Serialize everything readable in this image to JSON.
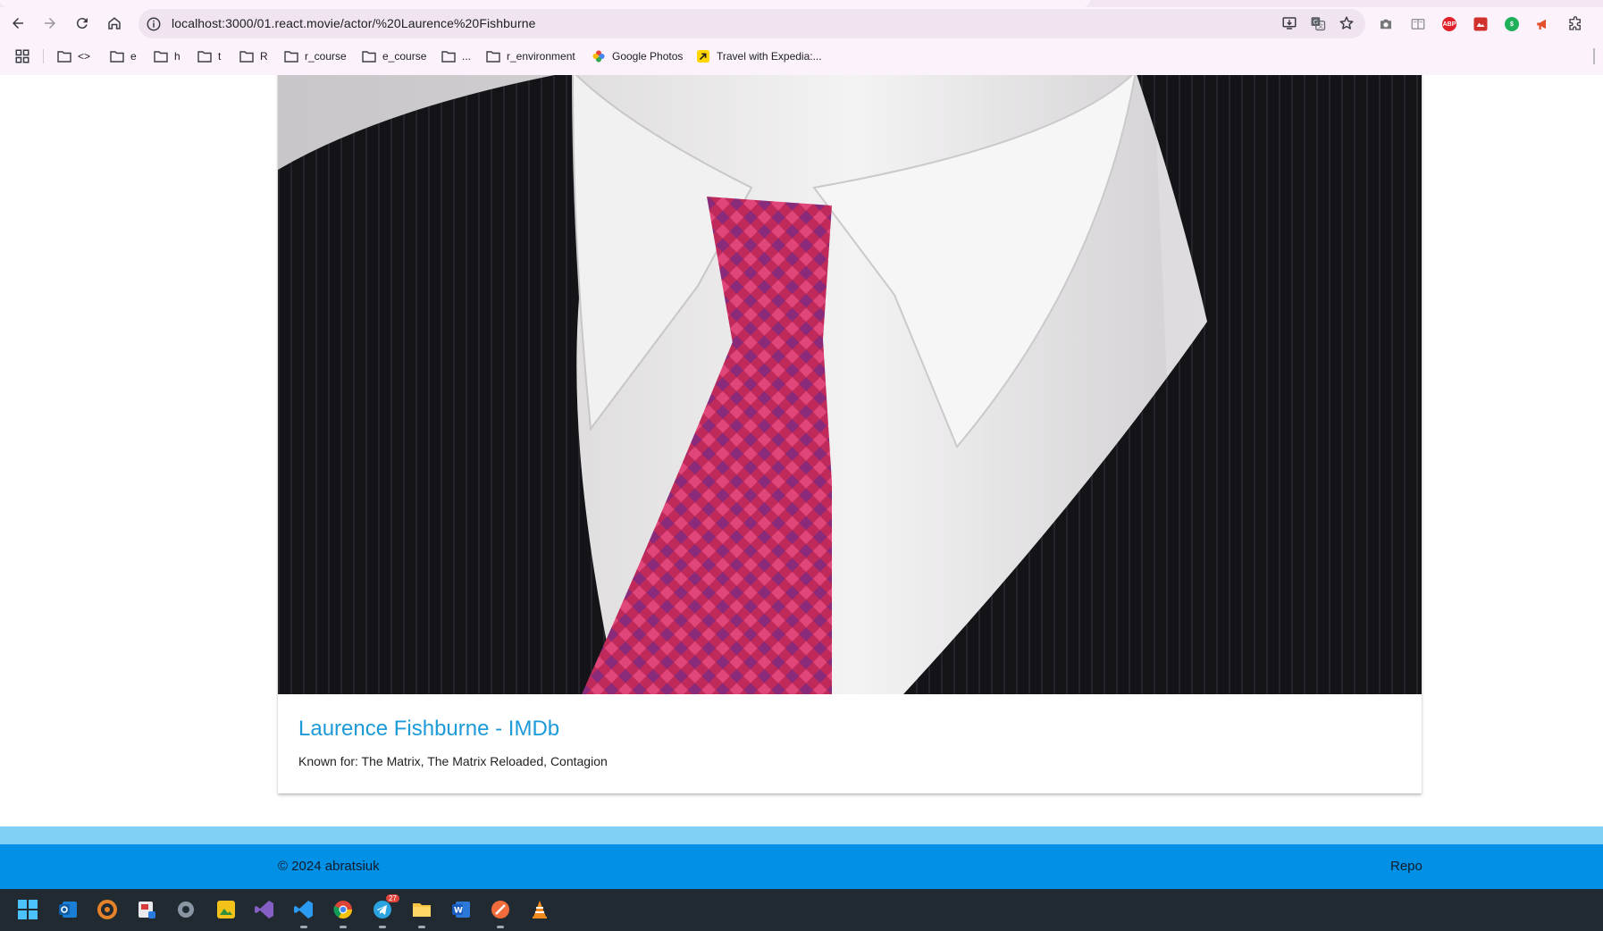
{
  "browser": {
    "url": "localhost:3000/01.react.movie/actor/%20Laurence%20Fishburne",
    "nav_icons": [
      "back-icon",
      "forward-icon",
      "reload-icon",
      "home-icon"
    ],
    "omnibox_icons": [
      "install-app-icon",
      "translate-icon",
      "bookmark-star-icon"
    ],
    "extensions": [
      "camera-icon",
      "reading-mode-icon",
      "adblock-icon",
      "red-extension-icon",
      "green-extension-icon",
      "megaphone-icon",
      "extensions-puzzle-icon"
    ],
    "bookmarks": [
      {
        "label": "<>",
        "icon": "folder-icon"
      },
      {
        "label": "e",
        "icon": "folder-icon"
      },
      {
        "label": "h",
        "icon": "folder-icon"
      },
      {
        "label": "t",
        "icon": "folder-icon"
      },
      {
        "label": "R",
        "icon": "folder-icon"
      },
      {
        "label": "r_course",
        "icon": "folder-icon"
      },
      {
        "label": "e_course",
        "icon": "folder-icon"
      },
      {
        "label": "...",
        "icon": "folder-icon"
      },
      {
        "label": "r_environment",
        "icon": "folder-icon"
      },
      {
        "label": "Google Photos",
        "icon": "google-photos-icon"
      },
      {
        "label": "Travel with Expedia:...",
        "icon": "expedia-icon"
      }
    ]
  },
  "actor_card": {
    "image_alt": "Laurence Fishburne photo",
    "title": "Laurence Fishburne - IMDb",
    "known_for": "Known for: The Matrix, The Matrix Reloaded, Contagion"
  },
  "footer": {
    "copyright": "© 2024 abratsiuk",
    "repo_link": "Repo"
  },
  "taskbar": {
    "apps": [
      "windows-start-icon",
      "outlook-icon",
      "app-swirl-icon",
      "snipping-tool-icon",
      "settings-icon",
      "photo-editor-icon",
      "visual-studio-icon",
      "vscode-icon",
      "chrome-icon",
      "telegram-icon",
      "file-explorer-icon",
      "word-icon",
      "orange-app-icon",
      "vlc-icon"
    ],
    "badges": {
      "telegram": "27"
    }
  },
  "colors": {
    "link": "#1d9ad8",
    "footer_primary": "#0090e6",
    "footer_light": "#80cff5",
    "chrome_bg": "#fbf2fb"
  }
}
